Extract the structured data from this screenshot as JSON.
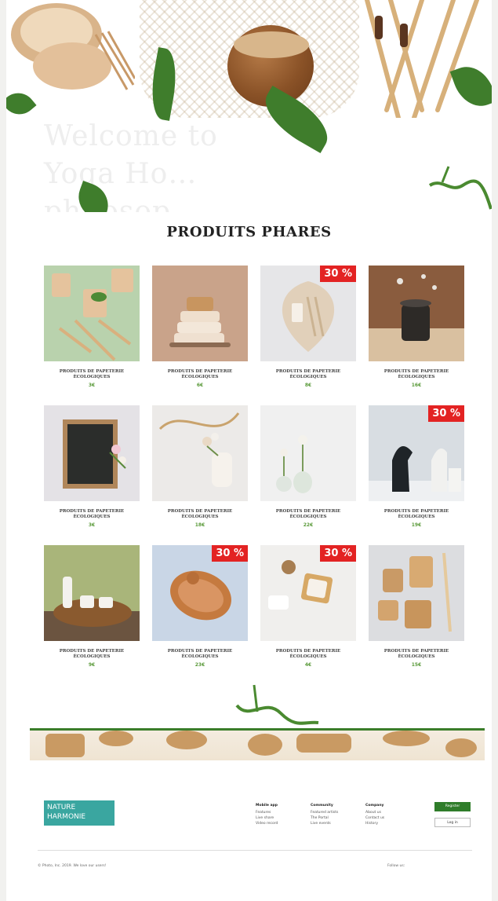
{
  "hero": {
    "ghost_text": "Welcome to Yoga Ho… philosop…"
  },
  "section_title": "PRODUITS PHARES",
  "products": [
    {
      "name": "PRODUITS DE PAPETERIE ÉCOLOGIQUES",
      "price": "3€",
      "badge": "",
      "image": "paper cups and wooden cutlery on green"
    },
    {
      "name": "PRODUITS DE PAPETERIE ÉCOLOGIQUES",
      "price": "6€",
      "badge": "",
      "image": "stack of soaps with brush"
    },
    {
      "name": "PRODUITS DE PAPETERIE ÉCOLOGIQUES",
      "price": "8€",
      "badge": "30 %",
      "image": "leaf plate with cutlery"
    },
    {
      "name": "PRODUITS DE PAPETERIE ÉCOLOGIQUES",
      "price": "16€",
      "badge": "",
      "image": "dark cups with splash"
    },
    {
      "name": "PRODUITS DE PAPETERIE ÉCOLOGIQUES",
      "price": "3€",
      "badge": "",
      "image": "chalkboard with flowers"
    },
    {
      "name": "PRODUITS DE PAPETERIE ÉCOLOGIQUES",
      "price": "18€",
      "badge": "",
      "image": "vase with rope and flowers"
    },
    {
      "name": "PRODUITS DE PAPETERIE ÉCOLOGIQUES",
      "price": "22€",
      "badge": "",
      "image": "glass vases with flowers"
    },
    {
      "name": "PRODUITS DE PAPETERIE ÉCOLOGIQUES",
      "price": "19€",
      "badge": "30 %",
      "image": "chess pieces"
    },
    {
      "name": "PRODUITS DE PAPETERIE ÉCOLOGIQUES",
      "price": "9€",
      "badge": "",
      "image": "tray with white cups"
    },
    {
      "name": "PRODUITS DE PAPETERIE ÉCOLOGIQUES",
      "price": "23€",
      "badge": "30 %",
      "image": "wooden tray on blue"
    },
    {
      "name": "PRODUITS DE PAPETERIE ÉCOLOGIQUES",
      "price": "4€",
      "badge": "30 %",
      "image": "wooden items on white"
    },
    {
      "name": "PRODUITS DE PAPETERIE ÉCOLOGIQUES",
      "price": "15€",
      "badge": "",
      "image": "paper cups and wooden spoons"
    }
  ],
  "footer": {
    "logo_line1": "NATURE",
    "logo_line2": "HARMONIE",
    "col1": {
      "heading": "Mobile app",
      "links": [
        "Features",
        "Live share",
        "Video record"
      ]
    },
    "col2": {
      "heading": "Community",
      "links": [
        "Featured artists",
        "The Portal",
        "Live events"
      ]
    },
    "col3": {
      "heading": "Company",
      "links": [
        "About us",
        "Contact us",
        "History"
      ]
    },
    "register_label": "Register",
    "login_label": "Log in",
    "copyright": "© Photo, Inc. 2019. We love our users!",
    "follow": "Follow us:"
  }
}
